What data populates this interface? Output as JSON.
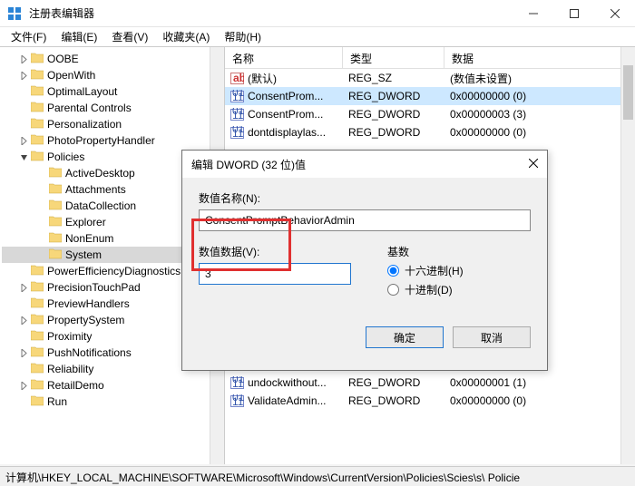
{
  "app": {
    "title": "注册表编辑器"
  },
  "menu": {
    "file": "文件(F)",
    "edit": "编辑(E)",
    "view": "查看(V)",
    "fav": "收藏夹(A)",
    "help": "帮助(H)"
  },
  "tree": {
    "items": [
      {
        "label": "OOBE",
        "depth": 1,
        "exp": "closed"
      },
      {
        "label": "OpenWith",
        "depth": 1,
        "exp": "closed"
      },
      {
        "label": "OptimalLayout",
        "depth": 1,
        "exp": "none"
      },
      {
        "label": "Parental Controls",
        "depth": 1,
        "exp": "none"
      },
      {
        "label": "Personalization",
        "depth": 1,
        "exp": "none"
      },
      {
        "label": "PhotoPropertyHandler",
        "depth": 1,
        "exp": "closed"
      },
      {
        "label": "Policies",
        "depth": 1,
        "exp": "open"
      },
      {
        "label": "ActiveDesktop",
        "depth": 2,
        "exp": "none"
      },
      {
        "label": "Attachments",
        "depth": 2,
        "exp": "none"
      },
      {
        "label": "DataCollection",
        "depth": 2,
        "exp": "none"
      },
      {
        "label": "Explorer",
        "depth": 2,
        "exp": "none"
      },
      {
        "label": "NonEnum",
        "depth": 2,
        "exp": "none"
      },
      {
        "label": "System",
        "depth": 2,
        "exp": "none",
        "selected": true
      },
      {
        "label": "PowerEfficiencyDiagnostics",
        "depth": 1,
        "exp": "none"
      },
      {
        "label": "PrecisionTouchPad",
        "depth": 1,
        "exp": "closed"
      },
      {
        "label": "PreviewHandlers",
        "depth": 1,
        "exp": "none"
      },
      {
        "label": "PropertySystem",
        "depth": 1,
        "exp": "closed"
      },
      {
        "label": "Proximity",
        "depth": 1,
        "exp": "none"
      },
      {
        "label": "PushNotifications",
        "depth": 1,
        "exp": "closed"
      },
      {
        "label": "Reliability",
        "depth": 1,
        "exp": "none"
      },
      {
        "label": "RetailDemo",
        "depth": 1,
        "exp": "closed"
      },
      {
        "label": "Run",
        "depth": 1,
        "exp": "none"
      }
    ]
  },
  "list": {
    "cols": {
      "name": "名称",
      "type": "类型",
      "data": "数据"
    },
    "rows": [
      {
        "name": "(默认)",
        "type": "REG_SZ",
        "data": "(数值未设置)",
        "icon": "str"
      },
      {
        "name": "ConsentProm...",
        "type": "REG_DWORD",
        "data": "0x00000000 (0)",
        "icon": "bin",
        "selected": true
      },
      {
        "name": "ConsentProm...",
        "type": "REG_DWORD",
        "data": "0x00000003 (3)",
        "icon": "bin"
      },
      {
        "name": "dontdisplaylas...",
        "type": "REG_DWORD",
        "data": "0x00000000 (0)",
        "icon": "bin"
      },
      {
        "name": "undockwithout...",
        "type": "REG_DWORD",
        "data": "0x00000001 (1)",
        "icon": "bin"
      },
      {
        "name": "ValidateAdmin...",
        "type": "REG_DWORD",
        "data": "0x00000000 (0)",
        "icon": "bin"
      }
    ]
  },
  "dialog": {
    "title": "编辑 DWORD (32 位)值",
    "name_label": "数值名称(N):",
    "name_value": "ConsentPromptBehaviorAdmin",
    "value_label": "数值数据(V):",
    "value_value": "3",
    "base_label": "基数",
    "hex": "十六进制(H)",
    "dec": "十进制(D)",
    "ok": "确定",
    "cancel": "取消"
  },
  "status": {
    "path": "计算机\\HKEY_LOCAL_MACHINE\\SOFTWARE\\Microsoft\\Windows\\CurrentVersion\\Policies\\Scies\\s\\ Policie"
  }
}
